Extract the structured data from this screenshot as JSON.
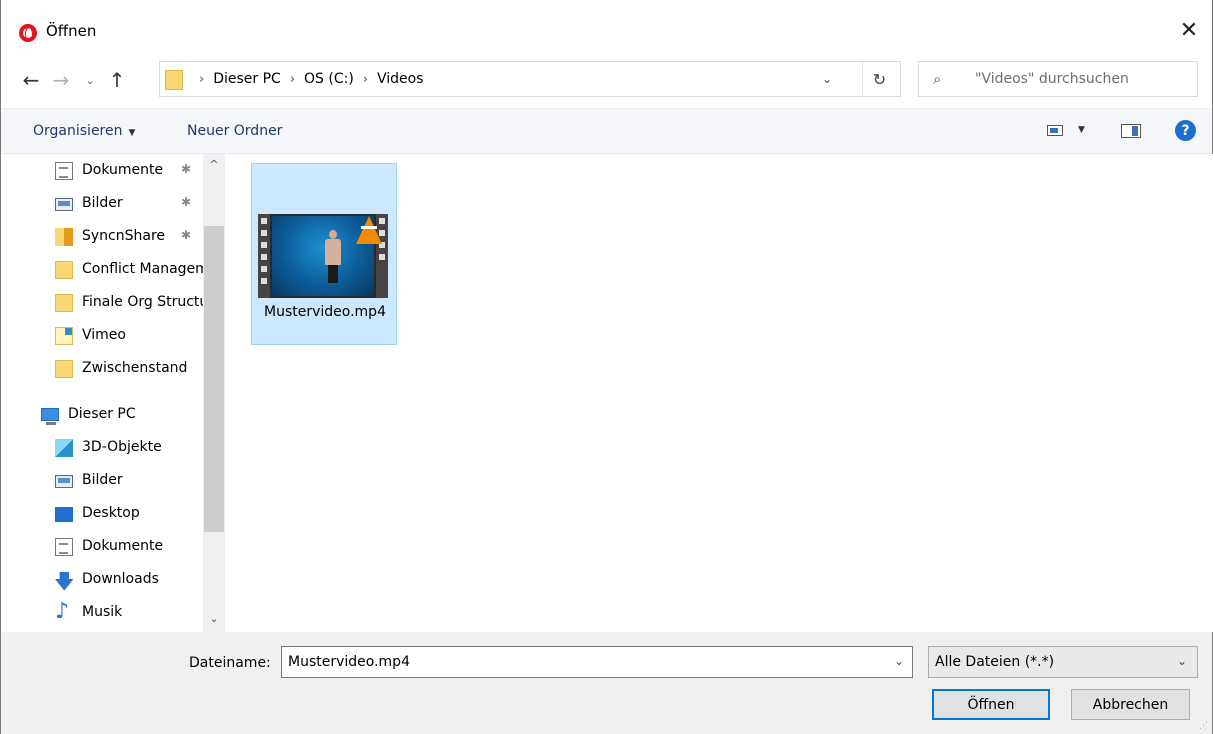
{
  "window": {
    "title": "Öffnen",
    "close_glyph": "✕"
  },
  "nav": {
    "back_glyph": "←",
    "forward_glyph": "→",
    "recent_glyph": "⌄",
    "up_glyph": "↑",
    "breadcrumbs": [
      "Dieser PC",
      "OS (C:)",
      "Videos"
    ],
    "separator": "›",
    "dropdown_glyph": "⌄",
    "refresh_glyph": "↻",
    "search_placeholder": "\"Videos\" durchsuchen",
    "search_glyph": "⌕"
  },
  "toolbar": {
    "organize_label": "Organisieren",
    "new_folder_label": "Neuer Ordner",
    "help_label": "?"
  },
  "sidebar": {
    "items": [
      {
        "label": "Dokumente",
        "icon": "documents-icon",
        "pinned": true
      },
      {
        "label": "Bilder",
        "icon": "pictures-icon",
        "pinned": true
      },
      {
        "label": "SyncnShare",
        "icon": "syncnshare-folder-icon",
        "pinned": true
      },
      {
        "label": "Conflict Management",
        "icon": "folder-icon",
        "pinned": false
      },
      {
        "label": "Finale Org Structure",
        "icon": "folder-icon",
        "pinned": false
      },
      {
        "label": "Vimeo",
        "icon": "vimeo-folder-icon",
        "pinned": false
      },
      {
        "label": "Zwischenstand",
        "icon": "folder-icon",
        "pinned": false
      },
      {
        "label": "Dieser PC",
        "icon": "this-pc-icon",
        "pinned": false
      },
      {
        "label": "3D-Objekte",
        "icon": "3d-objects-icon",
        "pinned": false
      },
      {
        "label": "Bilder",
        "icon": "pictures-icon",
        "pinned": false
      },
      {
        "label": "Desktop",
        "icon": "desktop-icon",
        "pinned": false
      },
      {
        "label": "Dokumente",
        "icon": "documents-icon",
        "pinned": false
      },
      {
        "label": "Downloads",
        "icon": "downloads-icon",
        "pinned": false
      },
      {
        "label": "Musik",
        "icon": "music-icon",
        "pinned": false
      }
    ],
    "pin_glyph": "📌",
    "scroll_up_glyph": "^",
    "scroll_down_glyph": "⌄"
  },
  "files": [
    {
      "name": "Mustervideo.mp4",
      "selected": true,
      "type": "video"
    }
  ],
  "footer": {
    "filename_label": "Dateiname:",
    "filename_value": "Mustervideo.mp4",
    "filter_value": "Alle Dateien (*.*)",
    "open_label": "Öffnen",
    "cancel_label": "Abbrechen"
  },
  "colors": {
    "selection_bg": "#cce8ff",
    "selection_border": "#99d1ff",
    "accent": "#0078d7",
    "brand": "#e0131e"
  }
}
